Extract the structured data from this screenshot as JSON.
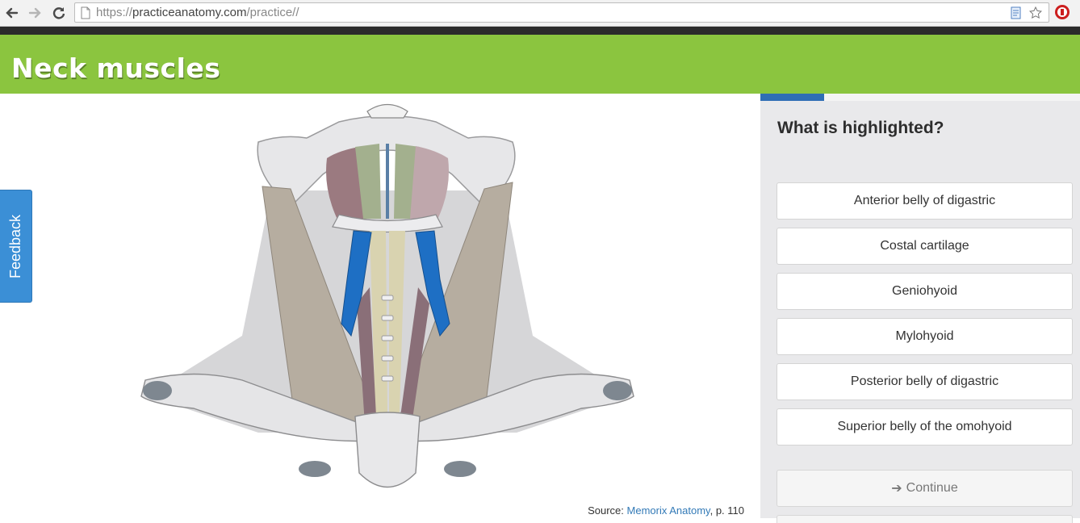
{
  "browser": {
    "url_scheme": "https://",
    "url_host": "practiceanatomy.com",
    "url_path": "/practice//"
  },
  "header": {
    "title": "Neck muscles",
    "color": "#8bc53f"
  },
  "feedback": {
    "label": "Feedback"
  },
  "illustration": {
    "source_prefix": "Source: ",
    "source_link": "Memorix Anatomy",
    "source_suffix": ", p. 110",
    "highlight_color": "#1e6fc4"
  },
  "quiz": {
    "progress_fraction": 0.2,
    "question": "What is highlighted?",
    "answers": [
      "Anterior belly of digastric",
      "Costal cartilage",
      "Geniohyoid",
      "Mylohyoid",
      "Posterior belly of digastric",
      "Superior belly of the omohyoid"
    ],
    "continue_label": "Continue"
  }
}
